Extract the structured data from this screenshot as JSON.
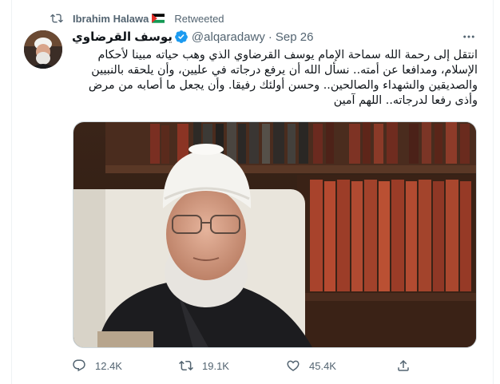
{
  "retweet": {
    "name": "Ibrahim Halawa",
    "flag_icon": "palestine-flag",
    "suffix": "Retweeted"
  },
  "tweet": {
    "display_name": "يوسف القرضاوي",
    "handle": "@alqaradawy",
    "separator": "·",
    "date": "Sep 26",
    "verified": true,
    "text": "انتقل إلى رحمة الله سماحة الإمام يوسف القرضاوي  الذي وهب حياته مبينا لأحكام الإسلام، ومدافعا عن أمته.. نسأل الله أن يرفع درجاته في عليين، وأن يلحقه بالنبيين والصديقين والشهداء والصالحين.. وحسن أولئك رفيقا. وأن يجعل ما أصابه من مرض وأذى رفعا لدرجاته.. اللهم آمين",
    "media_description": "photo-portrait"
  },
  "actions": {
    "replies": "12.4K",
    "retweets": "19.1K",
    "likes": "45.4K"
  },
  "colors": {
    "text_primary": "#0f1419",
    "text_secondary": "#536471",
    "verified_blue": "#1d9bf0",
    "border": "#cfd9de"
  },
  "icons": [
    "retweet-icon",
    "verified-icon",
    "more-icon",
    "reply-icon",
    "like-icon",
    "share-icon"
  ]
}
